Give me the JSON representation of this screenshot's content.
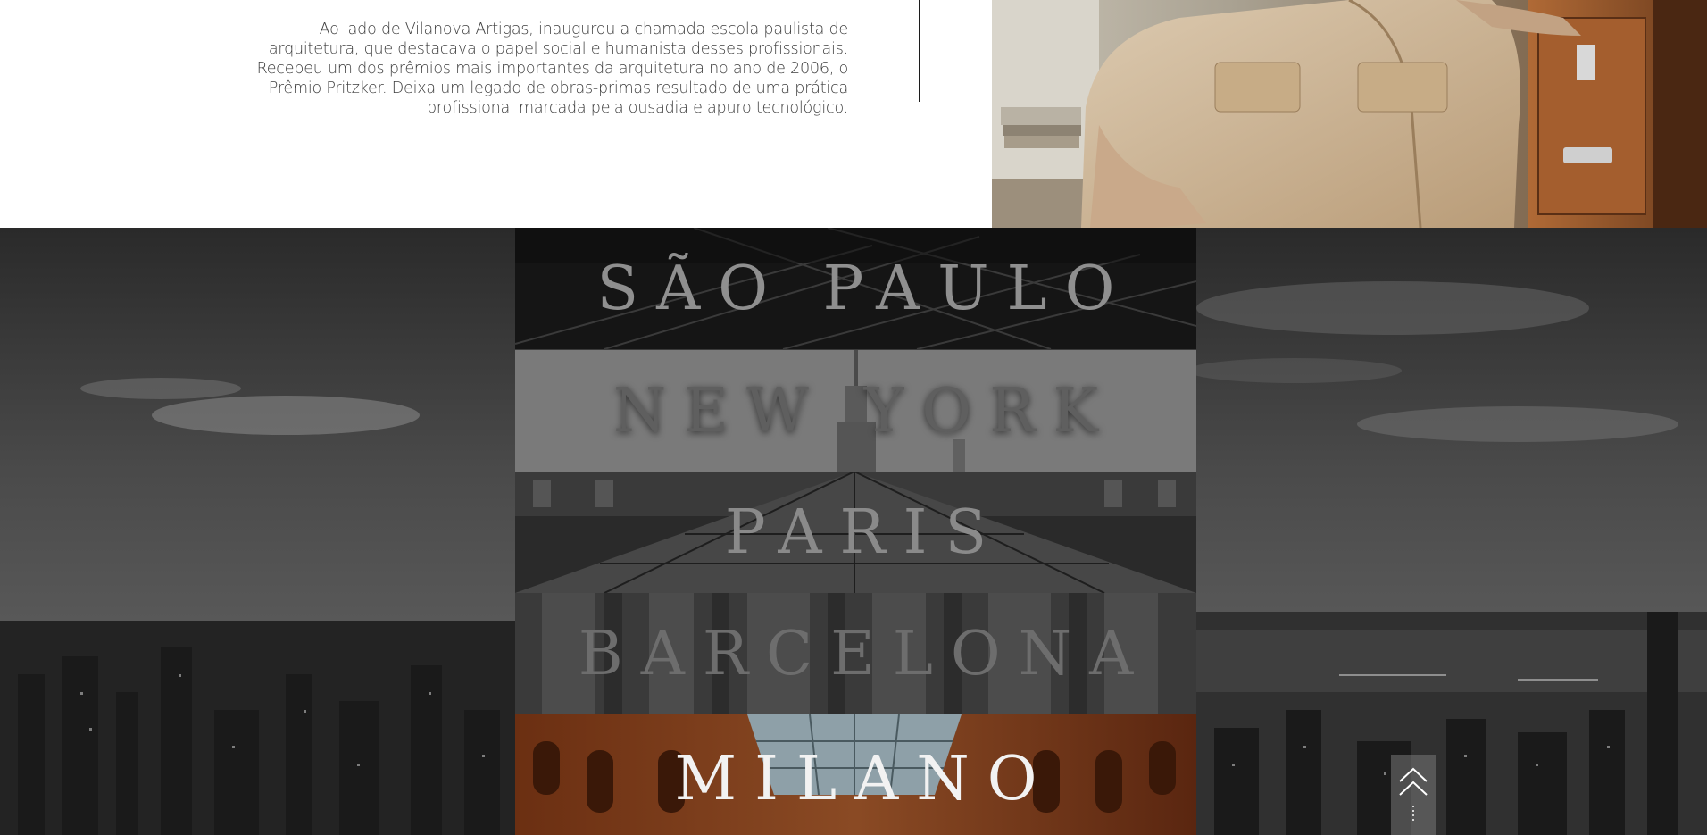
{
  "about": {
    "bio_text": "Ao lado de Vilanova Artigas, inaugurou a chamada escola paulista de arquitetura, que destacava o papel social e humanista desses profissionais. Recebeu um dos prêmios mais importantes da arquitetura no ano de 2006, o Prêmio Pritzker. Deixa um legado de obras-primas resultado de uma prática profissional marcada pela ousadia e apuro tecnológico."
  },
  "cities": [
    {
      "name": "SÃO PAULO"
    },
    {
      "name": "NEW YORK"
    },
    {
      "name": "PARIS"
    },
    {
      "name": "BARCELONA"
    },
    {
      "name": "MILANO"
    }
  ],
  "scroll_top": {
    "icon": "double-chevron-up-icon"
  }
}
